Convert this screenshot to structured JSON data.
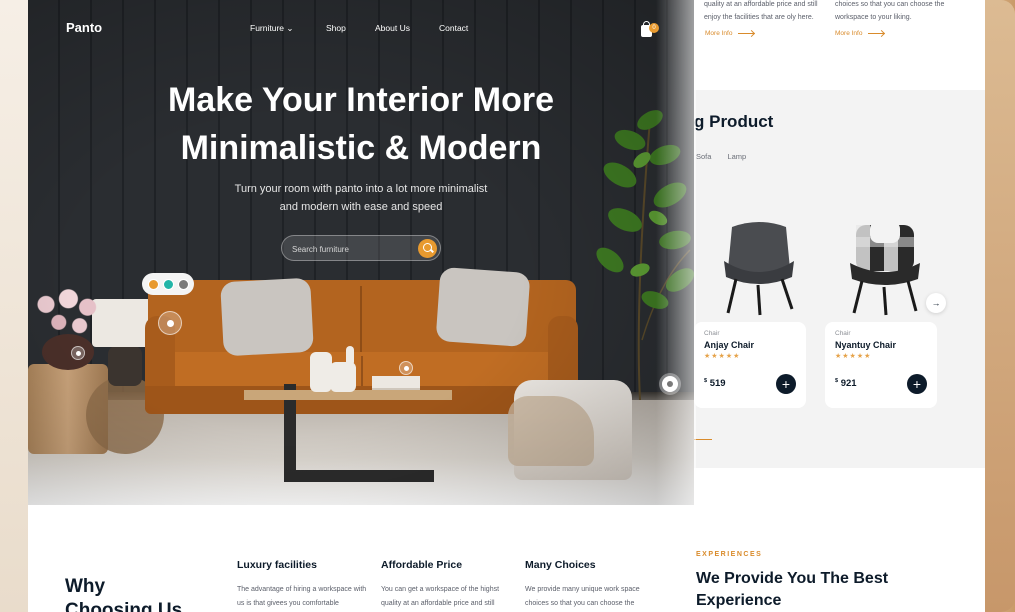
{
  "back_page": {
    "feature_text_1": "quality at an affordable price and still enjoy the facilities that are oly here.",
    "feature_text_2": "choices so that you can choose the workspace to your liking.",
    "more_info_1": "More Info",
    "more_info_2": "More Info",
    "products_title": "g Product",
    "categories": [
      "Sofa",
      "Lamp"
    ],
    "cards": [
      {
        "type": "Chair",
        "name": "Anjay Chair",
        "stars": "★★★★★",
        "currency": "$",
        "price": "519"
      },
      {
        "type": "Chair",
        "name": "Nyantuy Chair",
        "stars": "★★★★★",
        "currency": "$",
        "price": "921"
      }
    ],
    "add_symbol": "+",
    "next_arrow": "→",
    "experiences_label": "EXPERIENCES",
    "experiences_title": "We Provide You The Best Experience"
  },
  "nav": {
    "logo": "Panto",
    "items": [
      "Furniture",
      "Shop",
      "About Us",
      "Contact"
    ],
    "dropdown_icon": "chevron-down-icon",
    "cart_count": "0"
  },
  "hero": {
    "headline_line1": "Make Your Interior More",
    "headline_line2": "Minimalistic & Modern",
    "subline_line1": "Turn your room with panto into a lot more minimalist",
    "subline_line2": "and modern with ease and speed",
    "search_placeholder": "Search furniture",
    "swatch_colors": [
      "#e89a2f",
      "#22b5a8",
      "#7a7a7a"
    ]
  },
  "why": {
    "title_line1": "Why",
    "title_line2": "Choosing Us",
    "features": [
      {
        "title": "Luxury facilities",
        "text": "The advantage of hiring a workspace with us is that givees you comfortable"
      },
      {
        "title": "Affordable Price",
        "text": "You can get a workspace of the highst quality at an affordable price and still"
      },
      {
        "title": "Many Choices",
        "text": "We provide many unique work space choices so that you can choose the"
      }
    ]
  },
  "colors": {
    "accent": "#e89a2f",
    "dark": "#0d1b2a",
    "sofa": "#b3641f"
  }
}
